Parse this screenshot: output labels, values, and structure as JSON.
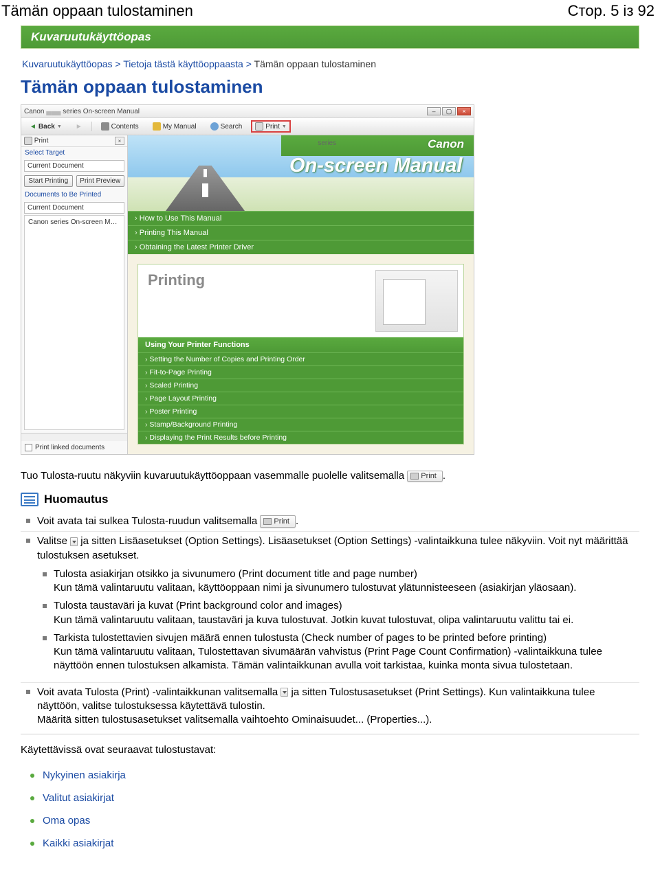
{
  "header": {
    "title": "Tämän oppaan tulostaminen",
    "page": "Стор. 5 із 92"
  },
  "banner": {
    "title": "Kuvaruutukäyttöopas"
  },
  "breadcrumb": {
    "a1": "Kuvaruutukäyttöopas",
    "a2": "Tietoja tästä käyttöoppaasta",
    "tail": "Tämän oppaan tulostaminen",
    "sep": " > "
  },
  "page_title": "Tämän oppaan tulostaminen",
  "screenshot": {
    "win_title_prefix": "Canon",
    "win_title_suffix": "series On-screen Manual",
    "toolbar": {
      "back": "Back",
      "fwd": "",
      "contents": "Contents",
      "my_manual": "My Manual",
      "search": "Search",
      "print": "Print"
    },
    "print_pane": {
      "title": "Print",
      "select_target": "Select Target",
      "current_doc": "Current Document",
      "start": "Start Printing",
      "preview": "Print Preview",
      "to_be": "Documents to Be Printed",
      "row1": "Current Document",
      "row2": "Canon        series On-screen Manual",
      "linked": "Print linked documents"
    },
    "hero": {
      "series": "series",
      "brand": "Canon",
      "title": "On-screen Manual"
    },
    "nav_items": [
      "How to Use This Manual",
      "Printing This Manual",
      "Obtaining the Latest Printer Driver"
    ],
    "cream": {
      "title": "Printing",
      "use_header": "Using Your Printer Functions",
      "use_items": [
        "Setting the Number of Copies and Printing Order",
        "Fit-to-Page Printing",
        "Scaled Printing",
        "Page Layout Printing",
        "Poster Printing",
        "Stamp/Background Printing",
        "Displaying the Print Results before Printing"
      ]
    }
  },
  "intro_para": "Tuo Tulosta-ruutu näkyviin kuvaruutukäyttöoppaan vasemmalle puolelle valitsemalla ",
  "print_btn": "Print",
  "note_title": "Huomautus",
  "note": {
    "li1_a": "Voit avata tai sulkea Tulosta-ruudun valitsemalla ",
    "li2_a": "Valitse ",
    "li2_b": " ja sitten Lisäasetukset (Option Settings). Lisäasetukset (Option Settings) -valintaikkuna tulee näkyviin. Voit nyt määrittää tulostuksen asetukset.",
    "sub1_t": "Tulosta asiakirjan otsikko ja sivunumero (Print document title and page number)",
    "sub1_b": "Kun tämä valintaruutu valitaan, käyttöoppaan nimi ja sivunumero tulostuvat ylätunnisteeseen (asiakirjan yläosaan).",
    "sub2_t": "Tulosta taustaväri ja kuvat (Print background color and images)",
    "sub2_b": "Kun tämä valintaruutu valitaan, taustaväri ja kuva tulostuvat. Jotkin kuvat tulostuvat, olipa valintaruutu valittu tai ei.",
    "sub3_t": "Tarkista tulostettavien sivujen määrä ennen tulostusta (Check number of pages to be printed before printing)",
    "sub3_b": "Kun tämä valintaruutu valitaan, Tulostettavan sivumäärän vahvistus (Print Page Count Confirmation) -valintaikkuna tulee näyttöön ennen tulostuksen alkamista. Tämän valintaikkunan avulla voit tarkistaa, kuinka monta sivua tulostetaan.",
    "li3_a": "Voit avata Tulosta (Print) -valintaikkunan valitsemalla ",
    "li3_b": " ja sitten Tulostusasetukset (Print Settings). Kun valintaikkuna tulee näyttöön, valitse tulostuksessa käytettävä tulostin.",
    "li3_c": "Määritä sitten tulostusasetukset valitsemalla vaihtoehto Ominaisuudet... (Properties...)."
  },
  "foot_title": "Käytettävissä ovat seuraavat tulostustavat:",
  "foot_items": [
    "Nykyinen asiakirja",
    "Valitut asiakirjat",
    "Oma opas",
    "Kaikki asiakirjat"
  ]
}
